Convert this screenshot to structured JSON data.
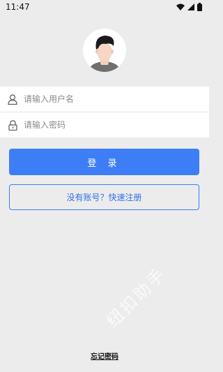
{
  "status_bar": {
    "time": "11:47",
    "icons": [
      "wifi-icon",
      "signal-icon",
      "battery-icon"
    ]
  },
  "login_form": {
    "username_placeholder": "请输入用户名",
    "password_placeholder": "请输入密码",
    "login_label": "登 录",
    "register_label": "没有账号？快速注册",
    "forgot_label": "忘记密码"
  },
  "watermark": "纽扣助手",
  "colors": {
    "primary": "#3d7ef7",
    "background": "#ececec",
    "panel": "#ffffff"
  }
}
